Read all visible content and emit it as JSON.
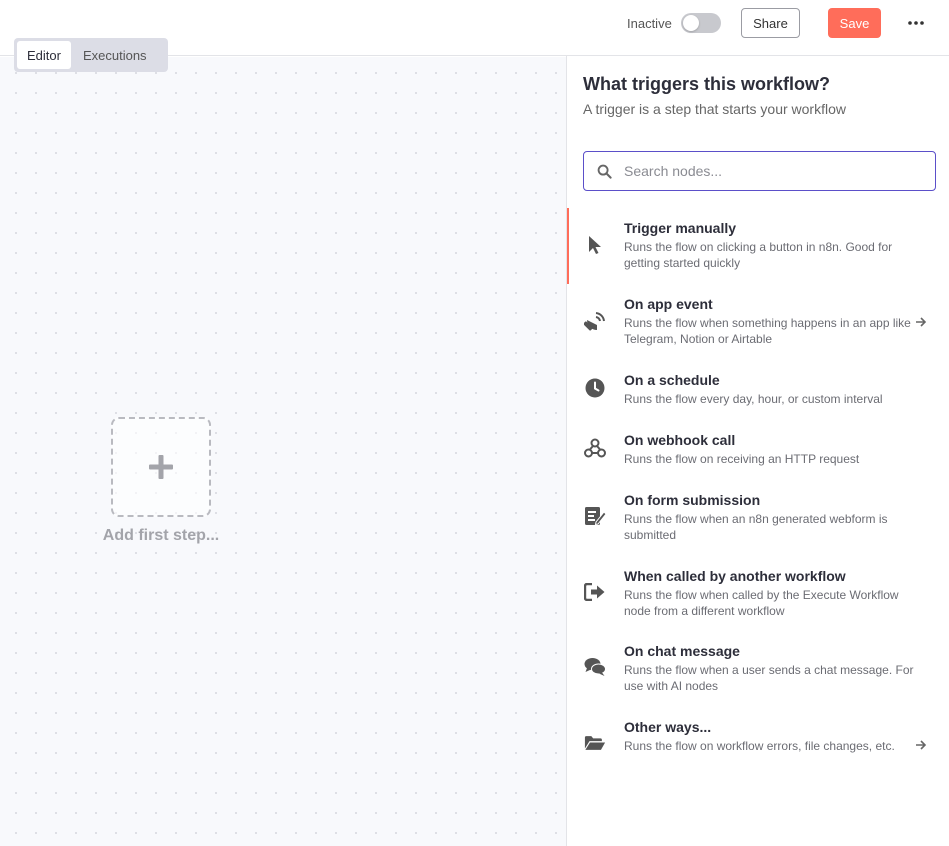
{
  "header": {
    "status_label": "Inactive",
    "share_label": "Share",
    "save_label": "Save",
    "more_icon": "ellipsis-icon",
    "accent_color": "#ff6d5a"
  },
  "canvas": {
    "tabs": [
      {
        "label": "Editor",
        "active": true
      },
      {
        "label": "Executions",
        "active": false
      }
    ],
    "add_step_label": "Add first step..."
  },
  "panel": {
    "title": "What triggers this workflow?",
    "subtitle": "A trigger is a step that starts your workflow",
    "search": {
      "placeholder": "Search nodes...",
      "value": ""
    },
    "items": [
      {
        "title": "Trigger manually",
        "description": "Runs the flow on clicking a button in n8n. Good for getting started quickly",
        "icon": "cursor-icon",
        "has_arrow": false
      },
      {
        "title": "On app event",
        "description": "Runs the flow when something happens in an app like Telegram, Notion or Airtable",
        "icon": "satellite-dish-icon",
        "has_arrow": true
      },
      {
        "title": "On a schedule",
        "description": "Runs the flow every day, hour, or custom interval",
        "icon": "clock-icon",
        "has_arrow": false
      },
      {
        "title": "On webhook call",
        "description": "Runs the flow on receiving an HTTP request",
        "icon": "webhook-icon",
        "has_arrow": false
      },
      {
        "title": "On form submission",
        "description": "Runs the flow when an n8n generated webform is submitted",
        "icon": "form-icon",
        "has_arrow": false
      },
      {
        "title": "When called by another workflow",
        "description": "Runs the flow when called by the Execute Workflow node from a different workflow",
        "icon": "sign-in-icon",
        "has_arrow": false
      },
      {
        "title": "On chat message",
        "description": "Runs the flow when a user sends a chat message. For use with AI nodes",
        "icon": "chat-icon",
        "has_arrow": false
      },
      {
        "title": "Other ways...",
        "description": "Runs the flow on workflow errors, file changes, etc.",
        "icon": "folder-open-icon",
        "has_arrow": true
      }
    ]
  }
}
